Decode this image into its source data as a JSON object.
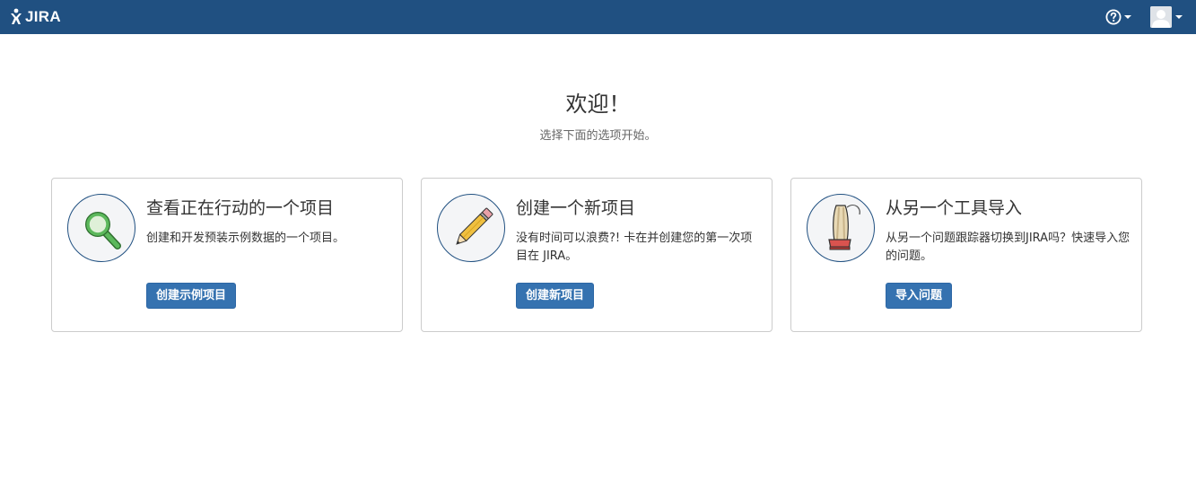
{
  "header": {
    "logo_text": "JIRA",
    "logo_icon": "jira-logo-icon",
    "help_icon": "help-icon",
    "user_icon": "avatar-icon",
    "background_color": "#205081"
  },
  "welcome": {
    "title": "欢迎！",
    "subtitle": "选择下面的选项开始。"
  },
  "cards": [
    {
      "icon": "magnifier-icon",
      "title": "查看正在行动的一个项目",
      "description": "创建和开发预装示例数据的一个项目。",
      "button_label": "创建示例项目"
    },
    {
      "icon": "pencil-icon",
      "title": "创建一个新项目",
      "description": "没有时间可以浪费?! 卡在并创建您的第一次项目在 JIRA。",
      "button_label": "创建新项目"
    },
    {
      "icon": "vacuum-icon",
      "title": "从另一个工具导入",
      "description": "从另一个问题跟踪器切换到JIRA吗？快速导入您的问题。",
      "button_label": "导入问题"
    }
  ],
  "colors": {
    "button": "#3572b0",
    "icon_circle_border": "#205081"
  }
}
